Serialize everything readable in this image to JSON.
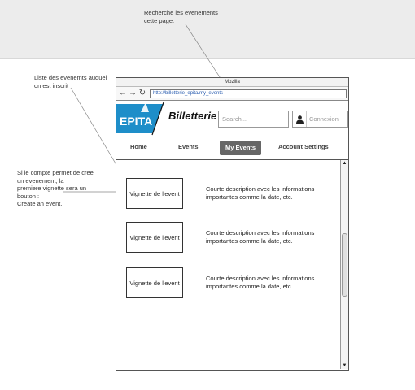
{
  "annotations": {
    "search_note": "Recherche les evenements\ncette page.",
    "list_note": "Liste des evenemts auquel\non est inscrit",
    "create_note": "Si le compte permet de cree\nun evenement, la\npremiere vignette sera un\nbouton :\nCreate an event."
  },
  "browser": {
    "title": "Mozilla",
    "url": "http://billetterie_epita/my_events",
    "icons": {
      "back": "arrow-left-icon",
      "forward": "arrow-right-icon",
      "reload": "reload-icon"
    }
  },
  "header": {
    "logo_text": "EPITA",
    "site_title": "Billetterie",
    "search_placeholder": "Search...",
    "login_label": "Connexion",
    "login_icon": "user-icon"
  },
  "menu": {
    "items": [
      {
        "label": "Home",
        "active": false
      },
      {
        "label": "Events",
        "active": false
      },
      {
        "label": "My Events",
        "active": true
      },
      {
        "label": "Account Settings",
        "active": false
      }
    ]
  },
  "events": [
    {
      "vignette": "Vignette de l'event",
      "description": "Courte description avec les informations importantes comme la date, etc."
    },
    {
      "vignette": "Vignette de l'event",
      "description": "Courte description avec les informations importantes comme la date, etc."
    },
    {
      "vignette": "Vignette de l'event",
      "description": "Courte description avec les informations importantes comme la date, etc."
    }
  ],
  "colors": {
    "logo_blue": "#1e8ec9",
    "active_tab": "#666666",
    "link_blue": "#2a5db0"
  }
}
